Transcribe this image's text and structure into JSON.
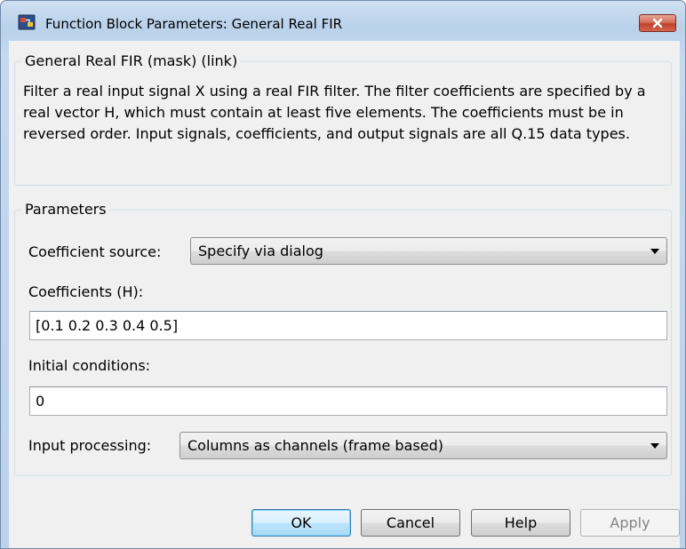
{
  "window": {
    "title": "Function Block Parameters: General Real FIR"
  },
  "mask": {
    "group_title": "General Real FIR (mask) (link)",
    "description": "Filter a real input signal X using a real FIR filter. The filter coefficients are specified by a real vector H, which must contain at least five elements. The coefficients must be in reversed order. Input signals, coefficients, and output signals are all Q.15 data types."
  },
  "parameters": {
    "group_title": "Parameters",
    "coefficient_source": {
      "label": "Coefficient source:",
      "value": "Specify via dialog"
    },
    "coefficients": {
      "label": "Coefficients (H):",
      "value": "[0.1 0.2 0.3 0.4 0.5]"
    },
    "initial_conditions": {
      "label": "Initial conditions:",
      "value": "0"
    },
    "input_processing": {
      "label": "Input processing:",
      "value": "Columns as channels (frame based)"
    }
  },
  "buttons": {
    "ok": "OK",
    "cancel": "Cancel",
    "help": "Help",
    "apply": "Apply"
  },
  "colors": {
    "close_button": "#c2412a",
    "default_button_border": "#3c7fb1",
    "client_background": "#f0f0f0"
  }
}
